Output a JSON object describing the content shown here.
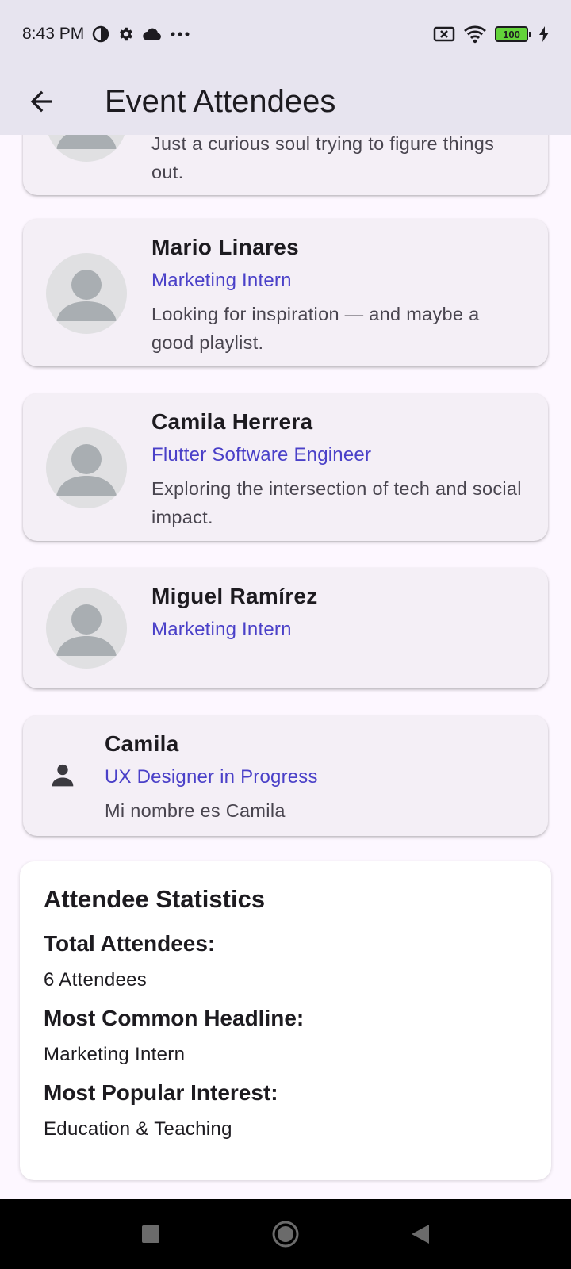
{
  "status_bar": {
    "time": "8:43 PM",
    "left_icons": [
      "data-saver-icon",
      "gear-icon",
      "cloud-icon",
      "more-dots-icon"
    ],
    "right_icons": [
      "no-sim-icon",
      "wifi-icon",
      "battery-icon",
      "charging-bolt-icon"
    ],
    "battery_level": "100"
  },
  "app_bar": {
    "title": "Event Attendees",
    "back_icon": "arrow-back-icon"
  },
  "attendees": [
    {
      "name": "",
      "headline": "",
      "bio": "Just a curious soul trying to figure things out."
    },
    {
      "name": "Mario Linares",
      "headline": "Marketing Intern",
      "bio": "Looking for inspiration — and maybe a good playlist."
    },
    {
      "name": "Camila Herrera",
      "headline": "Flutter Software Engineer",
      "bio": "Exploring the intersection of tech and social impact."
    },
    {
      "name": "Miguel Ramírez",
      "headline": "Marketing Intern",
      "bio": ""
    },
    {
      "name": "Camila",
      "headline": "UX Designer in Progress",
      "bio": "Mi nombre es Camila"
    }
  ],
  "stats": {
    "title": "Attendee Statistics",
    "total_label": "Total Attendees:",
    "total_value": "6 Attendees",
    "headline_label": "Most Common Headline:",
    "headline_value": "Marketing Intern",
    "interest_label": "Most Popular Interest:",
    "interest_value": "Education & Teaching"
  },
  "nav_bar": {
    "icons": [
      "recents-square-icon",
      "home-circle-icon",
      "back-triangle-icon"
    ]
  },
  "colors": {
    "accent": "#4a40c8",
    "app_bar_bg": "#e7e4ef",
    "card_bg": "#f4eff6",
    "page_bg": "#fdf7ff"
  }
}
